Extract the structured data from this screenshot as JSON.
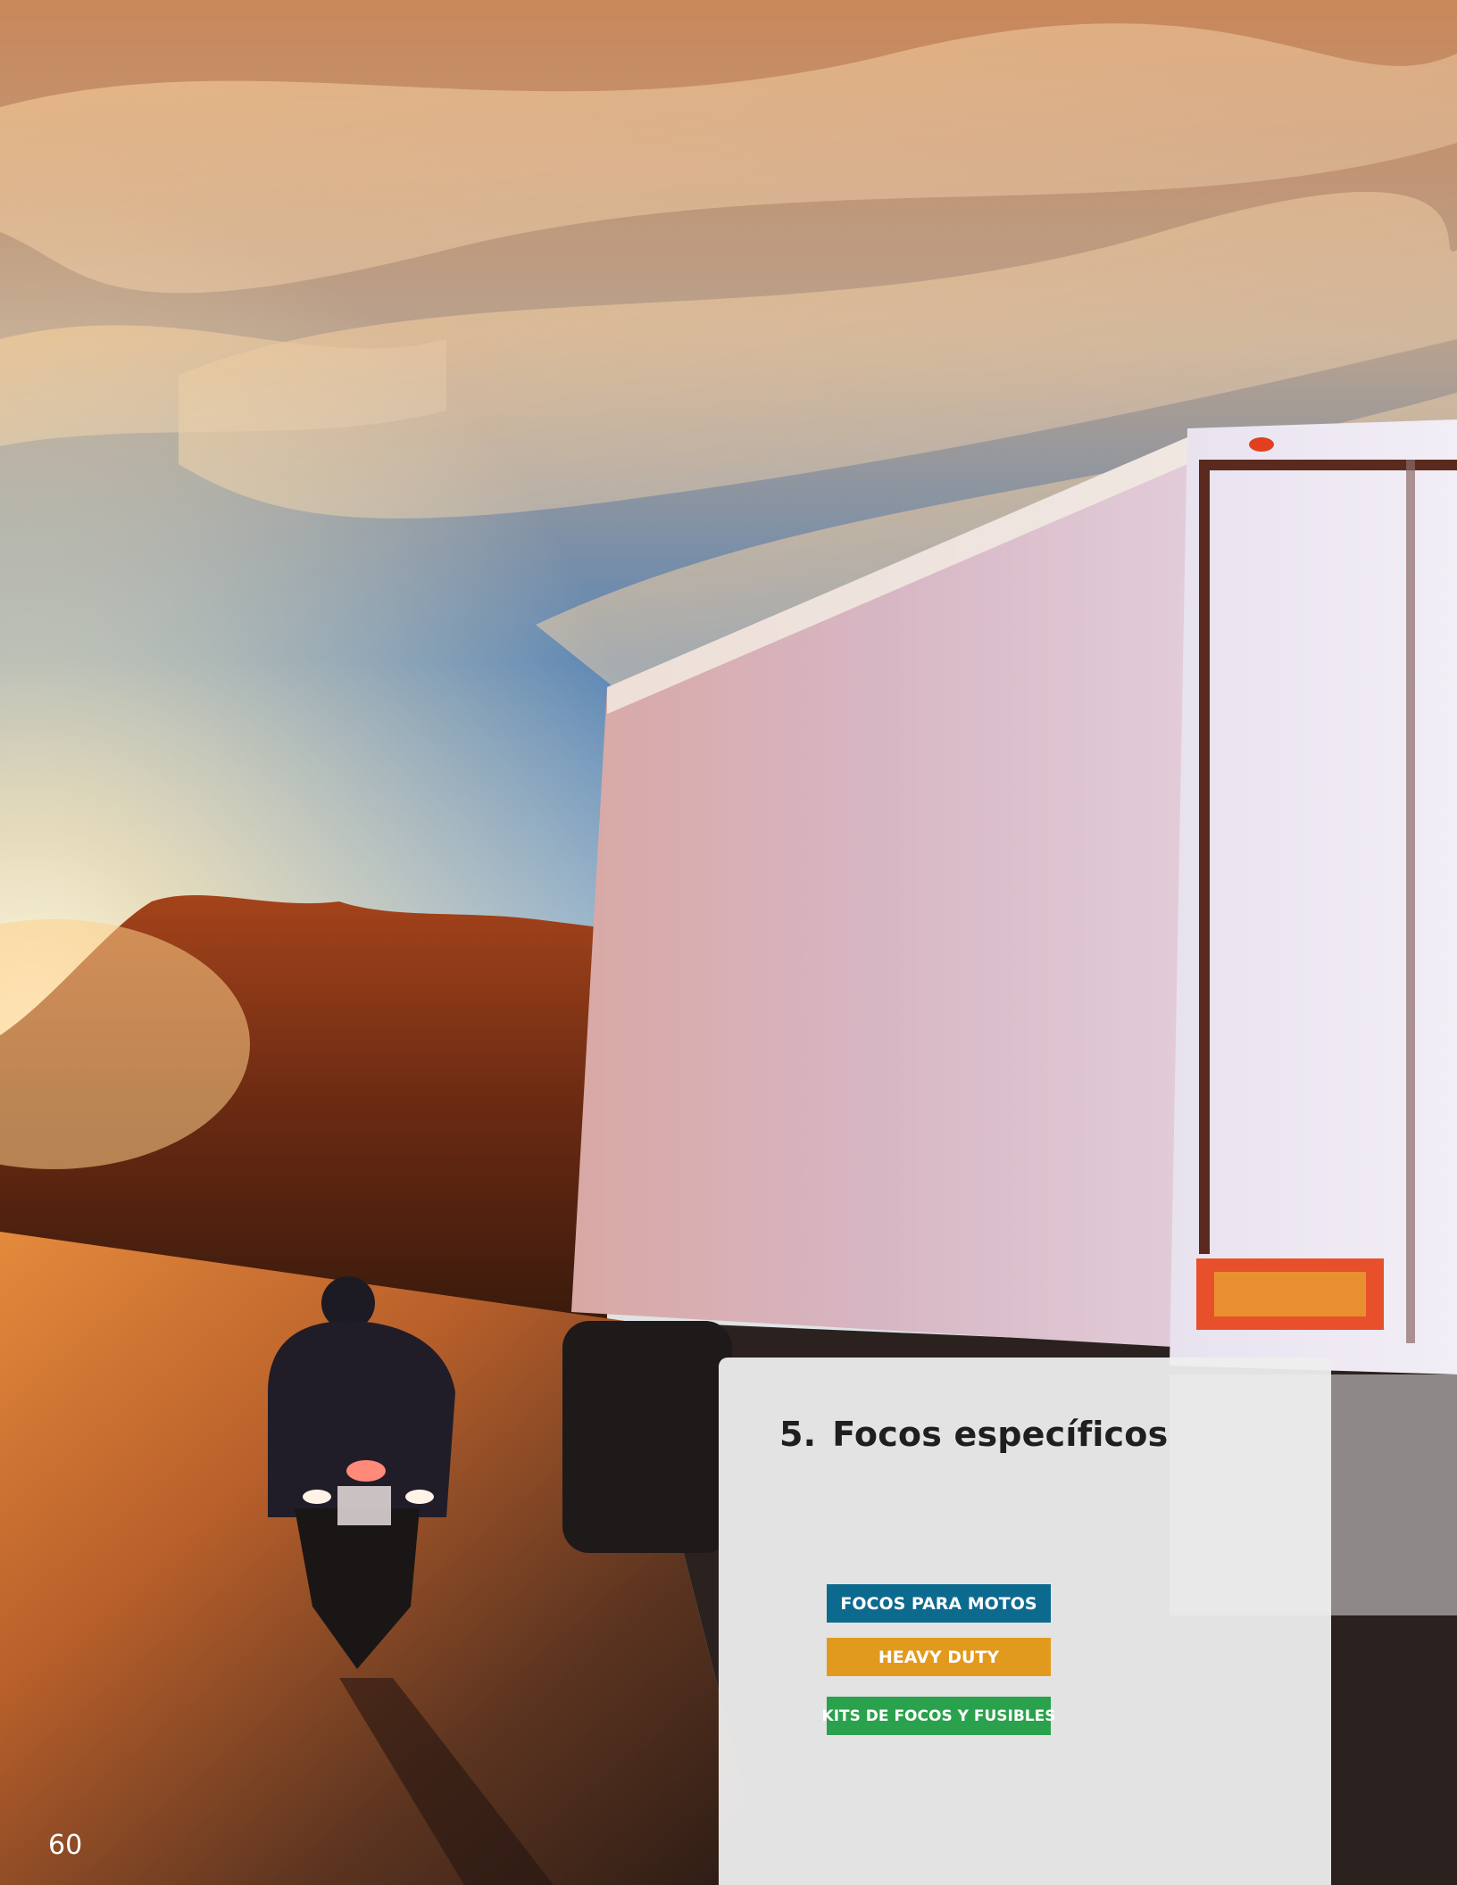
{
  "page": {
    "number": "60"
  },
  "section": {
    "number": "5.",
    "title": "Focos específicos"
  },
  "tags": [
    {
      "label": "FOCOS PARA MOTOS",
      "color": "#0d6a8f"
    },
    {
      "label": "HEAVY DUTY",
      "color": "#e29a1e"
    },
    {
      "label": "KITS DE FOCOS Y FUSIBLES",
      "color": "#2aa14c"
    }
  ],
  "photo": {
    "subject": "motorcycle-and-truck-on-road-at-sunset"
  }
}
